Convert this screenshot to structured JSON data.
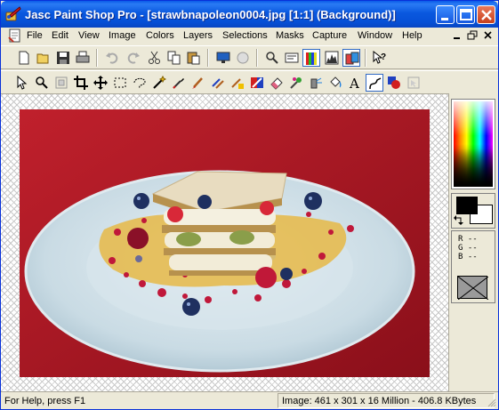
{
  "window": {
    "title": "Jasc Paint Shop Pro - [strawbnapoleon0004.jpg [1:1] (Background)]"
  },
  "menu": {
    "items": [
      {
        "label": "File"
      },
      {
        "label": "Edit"
      },
      {
        "label": "View"
      },
      {
        "label": "Image"
      },
      {
        "label": "Colors"
      },
      {
        "label": "Layers"
      },
      {
        "label": "Selections"
      },
      {
        "label": "Masks"
      },
      {
        "label": "Capture"
      },
      {
        "label": "Window"
      },
      {
        "label": "Help"
      }
    ]
  },
  "toolbar_standard": {
    "icons": [
      "new-icon",
      "open-icon",
      "save-icon",
      "print-icon",
      "undo-icon",
      "redo-icon",
      "cut-icon",
      "copy-icon",
      "paste-icon",
      "full-screen-preview-icon",
      "browse-icon",
      "overview-icon",
      "tool-options-icon",
      "color-palette-icon",
      "histogram-icon",
      "layer-palette-icon",
      "context-help-icon"
    ]
  },
  "toolbar_tools": {
    "icons": [
      "arrow-tool-icon",
      "zoom-tool-icon",
      "deformation-tool-icon",
      "crop-tool-icon",
      "mover-tool-icon",
      "selection-tool-icon",
      "freehand-tool-icon",
      "magic-wand-icon",
      "dropper-icon",
      "paintbrush-icon",
      "clone-brush-icon",
      "color-replacer-icon",
      "retouch-icon",
      "eraser-icon",
      "picture-tube-icon",
      "airbrush-icon",
      "flood-fill-icon",
      "text-tool-icon",
      "draw-tool-icon",
      "preset-shapes-icon",
      "object-selector-icon"
    ]
  },
  "colors": {
    "foreground": "#000000",
    "background": "#ffffff",
    "rgb_readout": {
      "r": "R --",
      "g": "G --",
      "b": "B --"
    }
  },
  "status": {
    "help": "For Help, press F1",
    "image_info": "Image:  461 x 301 x 16 Million - 406.8 KBytes"
  }
}
